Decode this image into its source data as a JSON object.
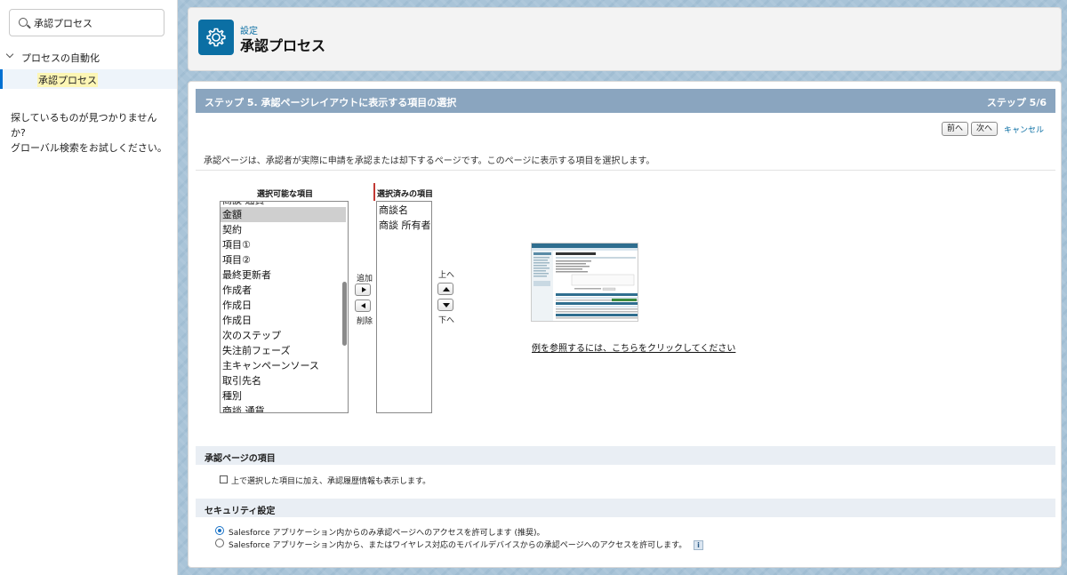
{
  "sidebar": {
    "search_value": "承認プロセス",
    "parent_label": "プロセスの自動化",
    "child_label": "承認プロセス",
    "help_text_line1": "探しているものが見つかりませんか?",
    "help_text_line2": "グローバル検索をお試しください。"
  },
  "header": {
    "breadcrumb": "設定",
    "title": "承認プロセス",
    "icon": "gear-icon"
  },
  "step": {
    "title": "ステップ 5. 承認ページレイアウトに表示する項目の選択",
    "counter": "ステップ 5/6"
  },
  "buttons": {
    "prev": "前へ",
    "next": "次へ",
    "cancel": "キャンセル",
    "add": "追加",
    "remove": "削除",
    "up": "上へ",
    "down": "下へ"
  },
  "description": "承認ページは、承認者が実際に申請を承認または却下するページです。このページに表示する項目を選択します。",
  "available": {
    "header": "選択可能な項目",
    "items": [
      "商談 通貨",
      "金額",
      "契約",
      "項目①",
      "項目②",
      "最終更新者",
      "作成者",
      "作成日",
      "作成日",
      "次のステップ",
      "失注前フェーズ",
      "主キャンペーンソース",
      "取引先名",
      "種別",
      "商談 通貨"
    ],
    "selected_index": 1
  },
  "selected": {
    "header": "選択済みの項目",
    "items": [
      "商談名",
      "商談 所有者"
    ]
  },
  "example_link": "例を参照するには、こちらをクリックしてください",
  "approval_section": {
    "title": "承認ページの項目",
    "checkbox_label": "上で選択した項目に加え、承認履歴情報も表示します。"
  },
  "security_section": {
    "title": "セキュリティ設定",
    "option1": "Salesforce アプリケーション内からのみ承認ページへのアクセスを許可します (推奨)。",
    "option2": "Salesforce アプリケーション内から、またはワイヤレス対応のモバイルデバイスからの承認ページへのアクセスを許可します。",
    "info_glyph": "i"
  },
  "colors": {
    "accent": "#0b6fa4",
    "step_bar": "#8aa5bf",
    "section_bar": "#e9eef4"
  }
}
